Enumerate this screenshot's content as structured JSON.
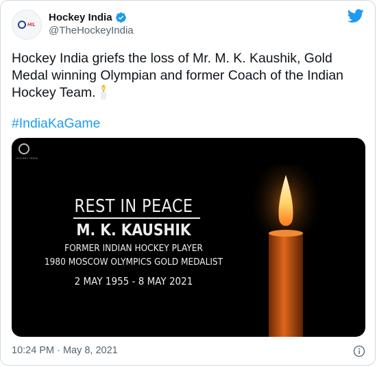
{
  "account": {
    "display_name": "Hockey India",
    "handle": "@TheHockeyIndia",
    "avatar_text": "HIL"
  },
  "tweet": {
    "text": "Hockey India griefs the loss of Mr. M. K. Kaushik, Gold Medal winning Olympian and former Coach of the Indian Hockey Team.",
    "hashtag": "#IndiaKaGame",
    "timestamp": "10:24 PM · May 8, 2021"
  },
  "media": {
    "title": "REST IN PEACE",
    "name": "M. K. KAUSHIK",
    "role": "FORMER INDIAN HOCKEY PLAYER",
    "achievement": "1980 MOSCOW OLYMPICS GOLD MEDALIST",
    "dates": "2 MAY 1955 - 8 MAY 2021",
    "logo_text": "HOCKEY INDIA"
  },
  "icons": {
    "verified": "verified-badge-icon",
    "brand": "twitter-bird-icon",
    "emoji": "candle-emoji-icon",
    "info": "info-icon"
  },
  "colors": {
    "link": "#1d9bf0",
    "verified": "#1d9bf0",
    "secondary_text": "#536471"
  }
}
